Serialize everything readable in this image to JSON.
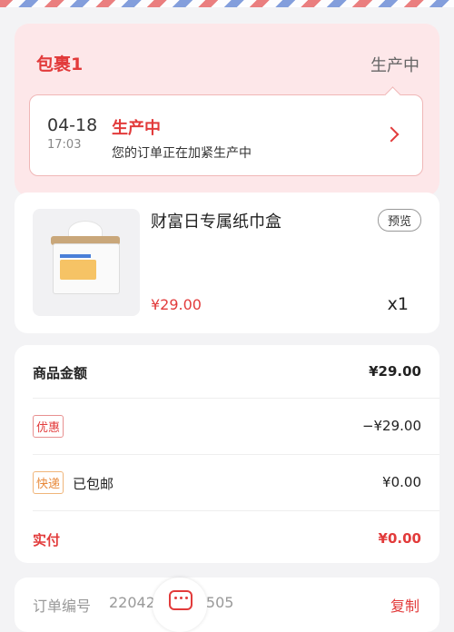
{
  "package": {
    "title": "包裹1",
    "status": "生产中",
    "timeline": {
      "date": "04-18",
      "time": "17:03",
      "status": "生产中",
      "description": "您的订单正在加紧生产中"
    }
  },
  "product": {
    "name": "财富日专属纸巾盒",
    "tag": "预览",
    "price": "¥29.00",
    "quantity": "x1"
  },
  "summary": {
    "goods_amount_label": "商品金额",
    "goods_amount_value": "¥29.00",
    "discount_tag": "优惠",
    "discount_value": "−¥29.00",
    "shipping_tag": "快递",
    "shipping_text": "已包邮",
    "shipping_value": "¥0.00",
    "paid_label": "实付",
    "paid_value": "¥0.00"
  },
  "order": {
    "number_label": "订单编号",
    "number_value": "22042      20003505",
    "copy_label": "复制"
  },
  "icons": {
    "chevron": "chevron-right-icon",
    "chat": "chat-icon"
  },
  "colors": {
    "accent": "#e23b3b",
    "package_bg": "#fde7e9",
    "shipping_tag": "#e8893a"
  }
}
